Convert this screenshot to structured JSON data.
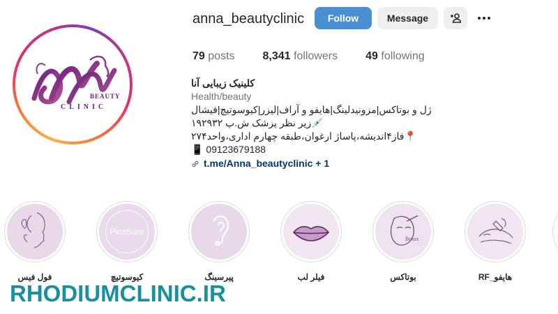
{
  "profile": {
    "username": "anna_beautyclinic",
    "logo_text_beauty": "BEAUTY",
    "logo_text_clinic": "CLINIC"
  },
  "actions": {
    "follow_label": "Follow",
    "message_label": "Message"
  },
  "stats": {
    "posts_count": "79",
    "posts_label": "posts",
    "followers_count": "8,341",
    "followers_label": "followers",
    "following_count": "49",
    "following_label": "following"
  },
  "bio": {
    "name": "کلینیک زیبایی آنا",
    "category": "Health/beauty",
    "line1": "ژل و بوتاکس|مزونیدلینگ|هایفو و آراف|لیزر|کیوسوتیچ|فیشال",
    "line2": "💉زیر نظر پزشک ش.پ ۱۹۲۹۳۲",
    "line3": "📍فاز۴اندیشه،پاساژ ارغوان،طبقه چهارم اداری،واحد۲۷۴",
    "line4": "📱 09123679188",
    "link": "t.me/Anna_beautyclinic + 1"
  },
  "highlights": [
    {
      "label": "فول فیس",
      "icon": "face-lineart-icon"
    },
    {
      "label": "کیوسوتیچ",
      "icon": "picosure-icon",
      "inner_text": "PicoSure"
    },
    {
      "label": "پیرسینگ",
      "icon": "ear-piercing-icon"
    },
    {
      "label": "فیلر لب",
      "icon": "lips-icon"
    },
    {
      "label": "بوتاکس",
      "icon": "botox-face-icon",
      "inner_text": "Botox"
    },
    {
      "label": "هایفو_RF",
      "icon": "face-treatment-icon"
    }
  ],
  "watermark": "RHODIUMCLINIC.IR",
  "colors": {
    "follow_blue": "#4a90d0",
    "highlight_bg": "#e8d8ea",
    "watermark": "#1a8fa0",
    "link": "#00376b"
  }
}
